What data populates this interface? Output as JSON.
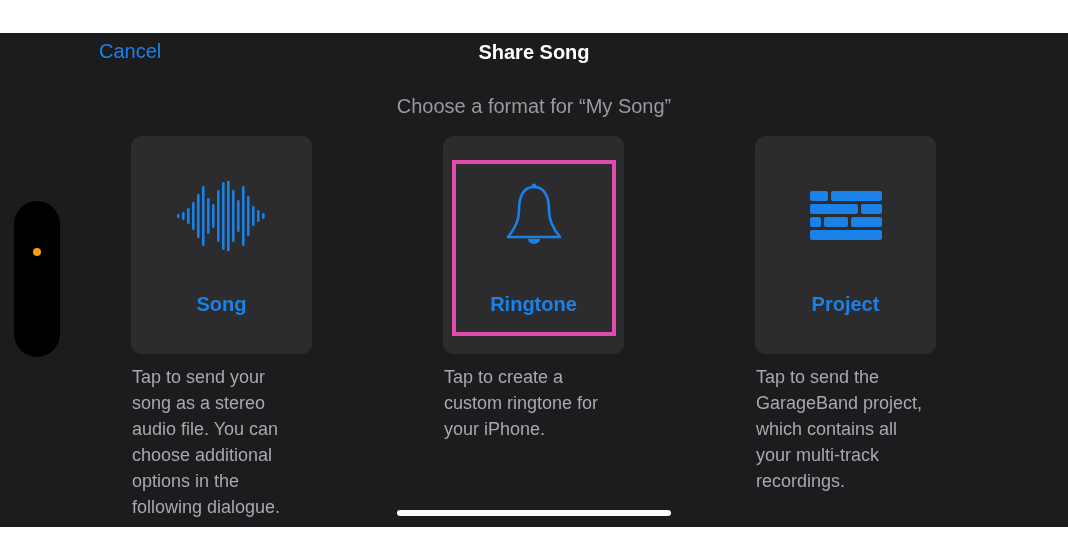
{
  "nav": {
    "cancel": "Cancel",
    "title": "Share Song"
  },
  "prompt": "Choose a format for “My Song”",
  "options": [
    {
      "kind": "waveform",
      "label": "Song",
      "highlighted": false,
      "description": "Tap to send your song as a stereo audio file. You can choose additional options in the following dialogue."
    },
    {
      "kind": "bell",
      "label": "Ringtone",
      "highlighted": true,
      "description": "Tap to create a custom ringtone for your iPhone."
    },
    {
      "kind": "bricks",
      "label": "Project",
      "highlighted": false,
      "description": "Tap to send the GarageBand project, which contains all your multi-track recordings."
    }
  ]
}
